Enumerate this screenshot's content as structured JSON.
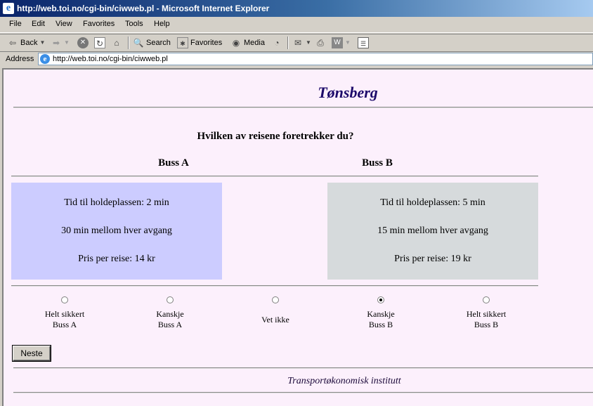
{
  "window": {
    "title": "http://web.toi.no/cgi-bin/ciwweb.pl - Microsoft Internet Explorer"
  },
  "menu": [
    "File",
    "Edit",
    "View",
    "Favorites",
    "Tools",
    "Help"
  ],
  "toolbar": {
    "back": "Back",
    "search": "Search",
    "favorites": "Favorites",
    "media": "Media"
  },
  "address": {
    "label": "Address",
    "url": "http://web.toi.no/cgi-bin/ciwweb.pl"
  },
  "page": {
    "title": "Tønsberg",
    "question": "Hvilken av reisene foretrekker du?",
    "options": [
      {
        "name": "Buss A",
        "color": "#ccccff",
        "lines": [
          "Tid til holdeplassen: 2 min",
          "30 min mellom hver avgang",
          "Pris per reise: 14 kr"
        ]
      },
      {
        "name": "Buss B",
        "color": "#d6dadc",
        "lines": [
          "Tid til holdeplassen: 5 min",
          "15 min mellom hver avgang",
          "Pris per reise: 19 kr"
        ]
      }
    ],
    "choices": [
      {
        "line1": "Helt sikkert",
        "line2": "Buss A",
        "selected": false
      },
      {
        "line1": "Kanskje",
        "line2": "Buss A",
        "selected": false
      },
      {
        "line1": "Vet ikke",
        "line2": "",
        "selected": false
      },
      {
        "line1": "Kanskje",
        "line2": "Buss B",
        "selected": true
      },
      {
        "line1": "Helt sikkert",
        "line2": "Buss B",
        "selected": false
      }
    ],
    "next_button": "Neste",
    "footer": "Transportøkonomisk institutt"
  }
}
